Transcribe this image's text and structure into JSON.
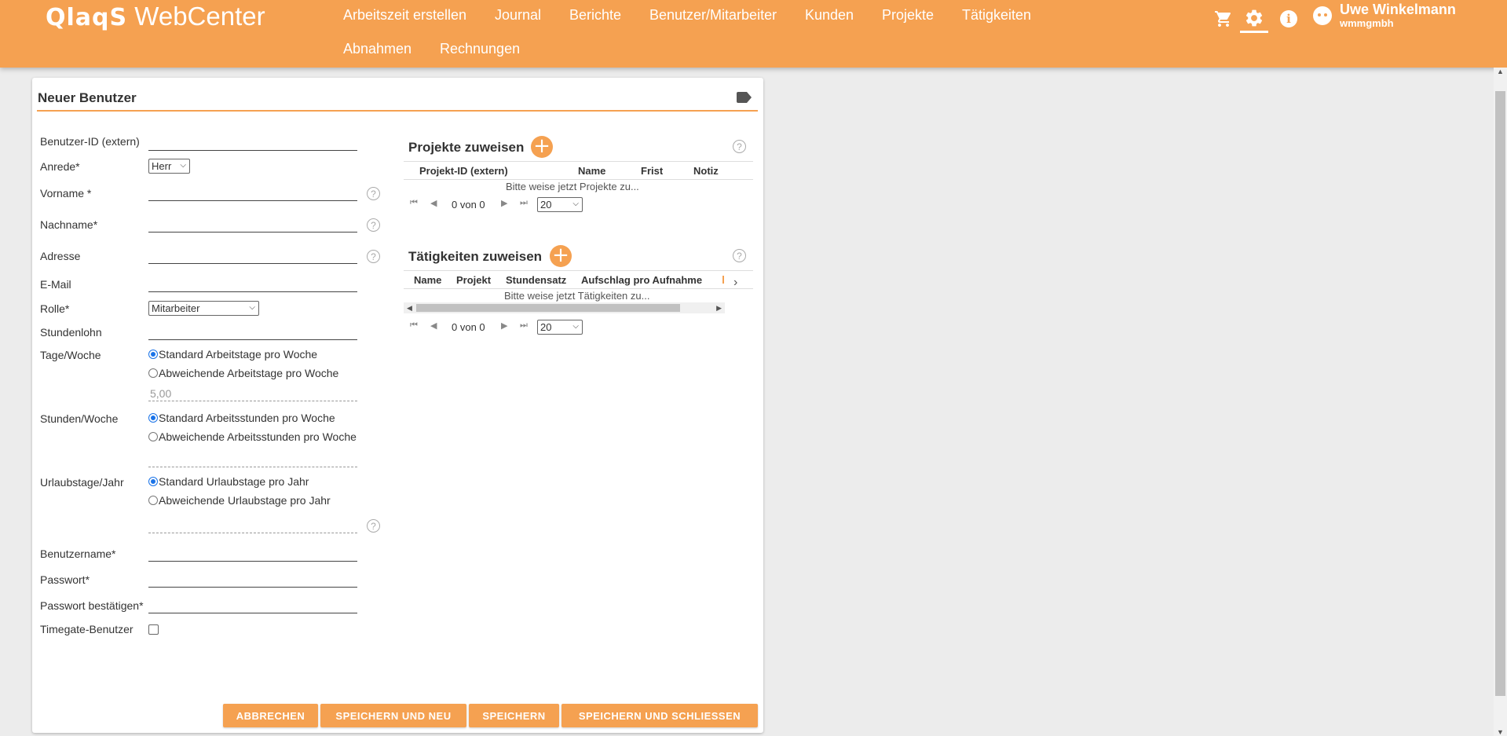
{
  "app": {
    "logo_bold": "QlaqS",
    "logo_text": "WebCenter"
  },
  "nav": {
    "items": [
      {
        "label": "Arbeitszeit erstellen"
      },
      {
        "label": "Journal"
      },
      {
        "label": "Berichte"
      },
      {
        "label": "Benutzer/Mitarbeiter"
      },
      {
        "label": "Kunden"
      },
      {
        "label": "Projekte"
      },
      {
        "label": "Tätigkeiten"
      },
      {
        "label": "Abnahmen"
      },
      {
        "label": "Rechnungen"
      }
    ]
  },
  "header_icons": {
    "cart": "cart-icon",
    "settings": "gear-icon",
    "info": "i",
    "user_icon": "user-face-icon"
  },
  "user": {
    "name": "Uwe Winkelmann",
    "company": "wmmgmbh"
  },
  "colors": {
    "accent": "#f5a151",
    "background": "#ececec"
  },
  "form": {
    "title": "Neuer Benutzer",
    "labels": {
      "user_id": "Benutzer-ID (extern)",
      "salutation": "Anrede*",
      "first_name": "Vorname *",
      "last_name": "Nachname*",
      "address": "Adresse",
      "email": "E-Mail",
      "role": "Rolle*",
      "hourly_wage": "Stundenlohn",
      "days_week": "Tage/Woche",
      "hours_week": "Stunden/Woche",
      "vacation": "Urlaubstage/Jahr",
      "username": "Benutzername*",
      "password": "Passwort*",
      "password_confirm": "Passwort bestätigen*",
      "timegate": "Timegate-Benutzer"
    },
    "values": {
      "salutation": "Herr",
      "role": "Mitarbeiter",
      "days_week": "5,00"
    },
    "radios": {
      "days_standard": "Standard Arbeitstage pro Woche",
      "days_custom": "Abweichende Arbeitstage pro Woche",
      "hours_standard": "Standard Arbeitsstunden pro Woche",
      "hours_custom": "Abweichende Arbeitsstunden pro Woche",
      "vac_standard": "Standard Urlaubstage pro Jahr",
      "vac_custom": "Abweichende Urlaubstage pro Jahr"
    },
    "help_glyph": "?"
  },
  "projects": {
    "title": "Projekte zuweisen",
    "columns": [
      "Projekt-ID (extern)",
      "Name",
      "Frist",
      "Notiz"
    ],
    "empty": "Bitte weise jetzt Projekte zu...",
    "pager_text": "0 von 0",
    "page_size": "20"
  },
  "activities": {
    "title": "Tätigkeiten zuweisen",
    "columns": [
      "Name",
      "Projekt",
      "Stundensatz",
      "Aufschlag pro Aufnahme"
    ],
    "empty": "Bitte weise jetzt Tätigkeiten zu...",
    "pager_text": "0 von 0",
    "page_size": "20"
  },
  "buttons": {
    "cancel": "ABBRECHEN",
    "save_new": "SPEICHERN UND NEU",
    "save": "SPEICHERN",
    "save_close": "SPEICHERN UND SCHLIESSEN"
  }
}
